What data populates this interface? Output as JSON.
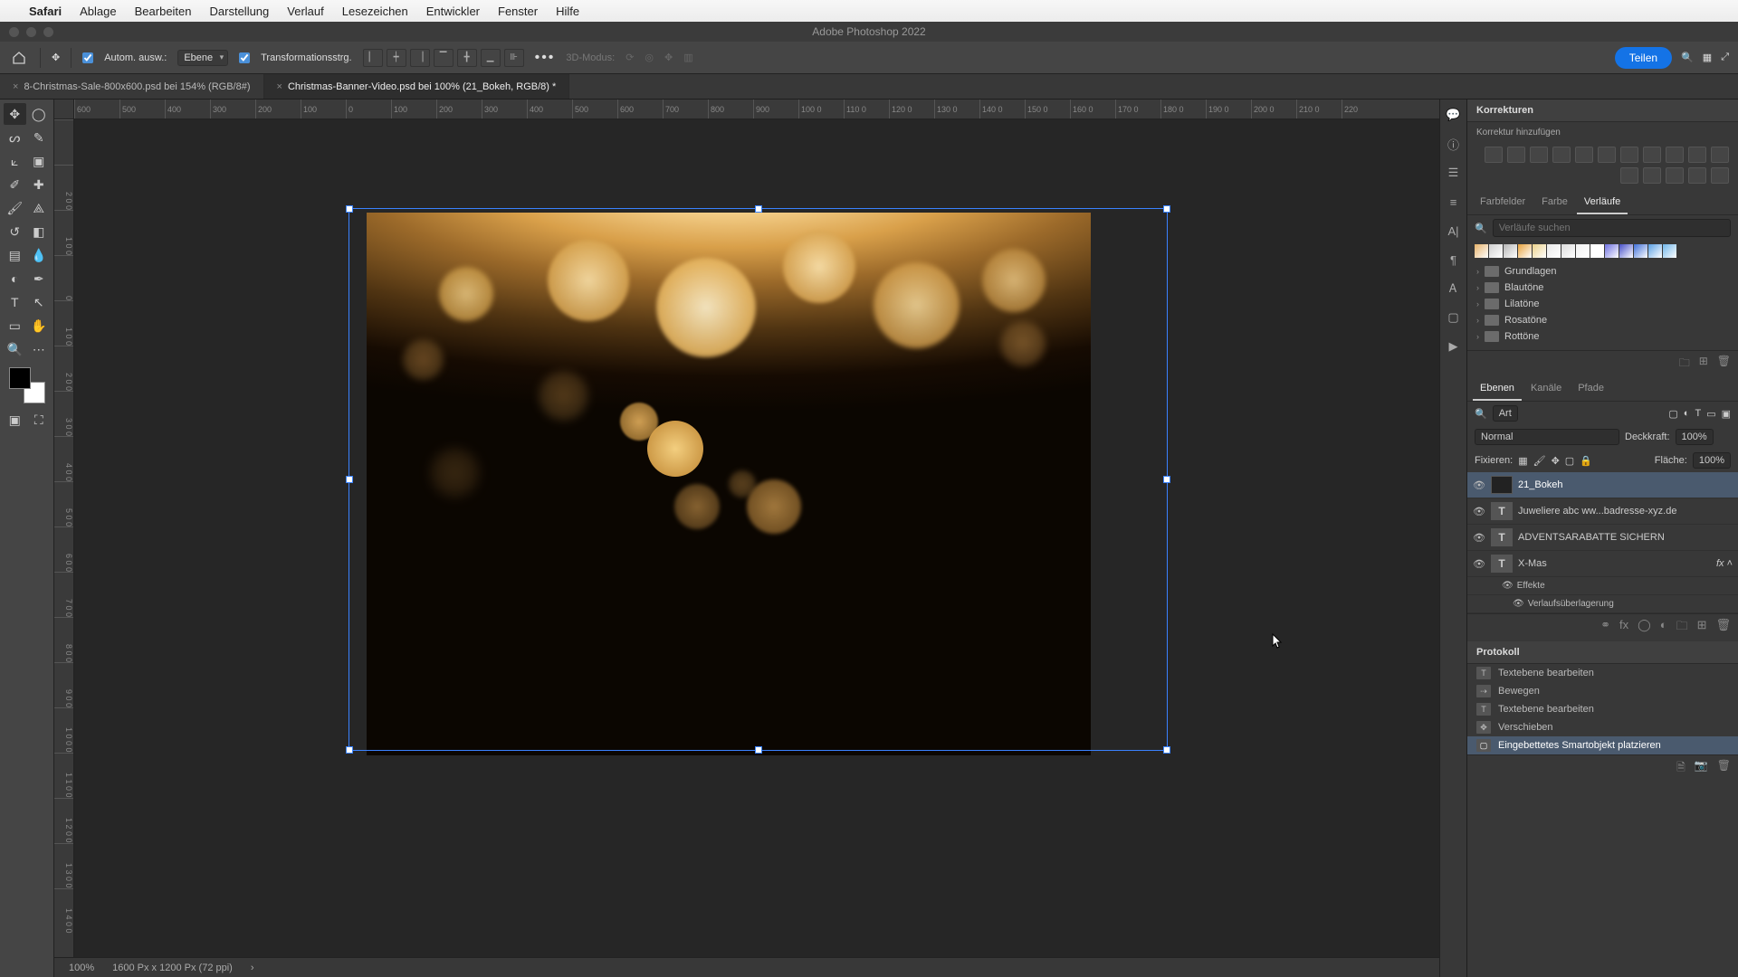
{
  "mac_menu": {
    "apple": "",
    "app": "Safari",
    "items": [
      "Ablage",
      "Bearbeiten",
      "Darstellung",
      "Verlauf",
      "Lesezeichen",
      "Entwickler",
      "Fenster",
      "Hilfe"
    ]
  },
  "window": {
    "title": "Adobe Photoshop 2022"
  },
  "options": {
    "auto_select": "Autom. ausw.:",
    "layer_dd": "Ebene",
    "transform": "Transformationsstrg.",
    "mode3d": "3D-Modus:",
    "share": "Teilen"
  },
  "doc_tabs": [
    {
      "label": "8-Christmas-Sale-800x600.psd bei 154% (RGB/8#)",
      "active": false
    },
    {
      "label": "Christmas-Banner-Video.psd bei 100% (21_Bokeh, RGB/8) *",
      "active": true
    }
  ],
  "ruler_h": [
    "600",
    "500",
    "400",
    "300",
    "200",
    "100",
    "0",
    "100",
    "200",
    "300",
    "400",
    "500",
    "600",
    "700",
    "800",
    "900",
    "100 0",
    "110 0",
    "120 0",
    "130 0",
    "140 0",
    "150 0",
    "160 0",
    "170 0",
    "180 0",
    "190 0",
    "200 0",
    "210 0",
    "220"
  ],
  "ruler_v": [
    "",
    "2 0 0",
    "1 0 0",
    "0",
    "1 0 0",
    "2 0 0",
    "3 0 0",
    "4 0 0",
    "5 0 0",
    "6 0 0",
    "7 0 0",
    "8 0 0",
    "9 0 0",
    "1 0 0 0",
    "1 1 0 0",
    "1 2 0 0",
    "1 3 0 0",
    "1 4 0 0"
  ],
  "status": {
    "zoom": "100%",
    "info": "1600 Px x 1200 Px (72 ppi)",
    "chev": "›"
  },
  "panels": {
    "korrekturen": "Korrekturen",
    "korrektur_add": "Korrektur hinzufügen",
    "color_tabs": [
      "Farbfelder",
      "Farbe",
      "Verläufe"
    ],
    "search_placeholder": "Verläufe suchen",
    "folders": [
      "Grundlagen",
      "Blautöne",
      "Lilatöne",
      "Rosatöne",
      "Rottöne"
    ]
  },
  "layers_panel": {
    "tabs": [
      "Ebenen",
      "Kanäle",
      "Pfade"
    ],
    "filter": "Art",
    "blend": "Normal",
    "opacity_label": "Deckkraft:",
    "opacity": "100%",
    "lock_label": "Fixieren:",
    "fill_label": "Fläche:",
    "fill": "100%",
    "layers": [
      {
        "name": "21_Bokeh",
        "type": "smart",
        "selected": true
      },
      {
        "name": "Juweliere abc ww...badresse-xyz.de",
        "type": "text"
      },
      {
        "name": "ADVENTSARABATTE SICHERN",
        "type": "text"
      },
      {
        "name": "X-Mas",
        "type": "text",
        "fx": true
      }
    ],
    "fx_label": "fx",
    "effects": "Effekte",
    "effect_item": "Verlaufsüberlagerung"
  },
  "history": {
    "title": "Protokoll",
    "items": [
      {
        "label": "Textebene bearbeiten",
        "icon": "T"
      },
      {
        "label": "Bewegen",
        "icon": "⇢"
      },
      {
        "label": "Textebene bearbeiten",
        "icon": "T"
      },
      {
        "label": "Verschieben",
        "icon": "✥"
      },
      {
        "label": "Eingebettetes Smartobjekt platzieren",
        "icon": "▢",
        "selected": true
      }
    ]
  },
  "swatch_colors": [
    "#e7b36a",
    "#d0d0d0",
    "#b4b4b4",
    "#e8a23c",
    "#ecd28a",
    "#e9e9e9",
    "#dcdcdc",
    "#f2f2f2",
    "#ffffff",
    "#6d6fe0",
    "#4750c8",
    "#3f6fd8",
    "#5aa0e5",
    "#6fb6ea"
  ]
}
